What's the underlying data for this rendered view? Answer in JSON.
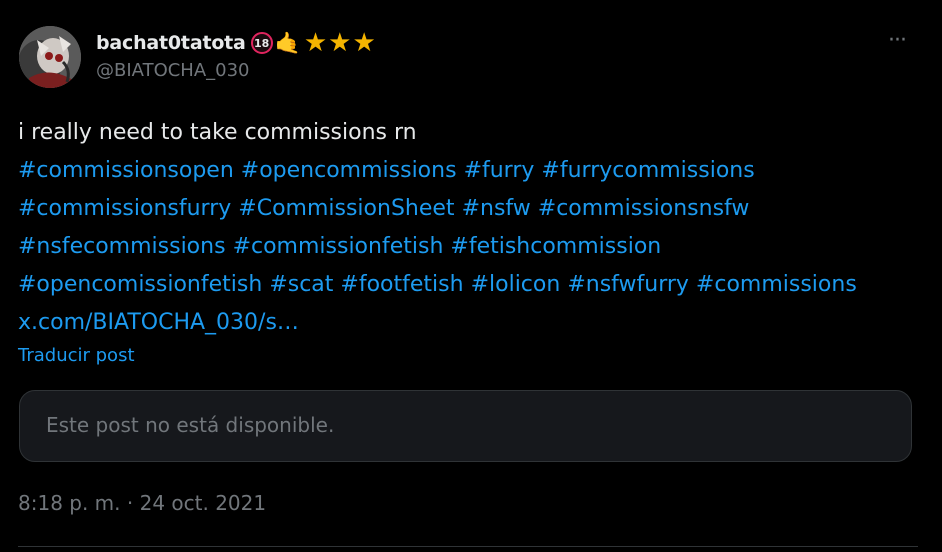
{
  "author": {
    "display_name": "bachat0tatota",
    "badge": "18",
    "hand_emoji": "🤙",
    "stars": "★★★",
    "handle": "@BIATOCHA_030"
  },
  "more_button": "···",
  "post": {
    "text": "i really need to take commissions rn",
    "hashtags": [
      "#commissionsopen",
      "#opencommissions",
      "#furry",
      "#furrycommissions",
      "#commissionsfurry",
      "#CommissionSheet",
      "#nsfw",
      "#commissionsnsfw",
      "#nsfecommissions",
      "#commissionfetish",
      "#fetishcommission",
      "#opencomissionfetish",
      "#scat",
      "#footfetish",
      "#lolicon",
      "#nsfwfurry",
      "#commissions"
    ],
    "link": "x.com/BIATOCHA_030/s…",
    "translate_label": "Traducir post"
  },
  "quoted_post": {
    "unavailable_text": "Este post no está disponible."
  },
  "timestamp": "8:18 p. m. · 24 oct. 2021",
  "colors": {
    "background": "#000000",
    "text": "#e7e9ea",
    "link": "#1d9bf0",
    "muted": "#71767b",
    "card": "#16181c",
    "border": "#2f3336",
    "star": "#f4b400"
  },
  "icons": [
    "avatar",
    "more-icon",
    "adult-18-badge",
    "call-me-hand-emoji",
    "star-icon"
  ]
}
